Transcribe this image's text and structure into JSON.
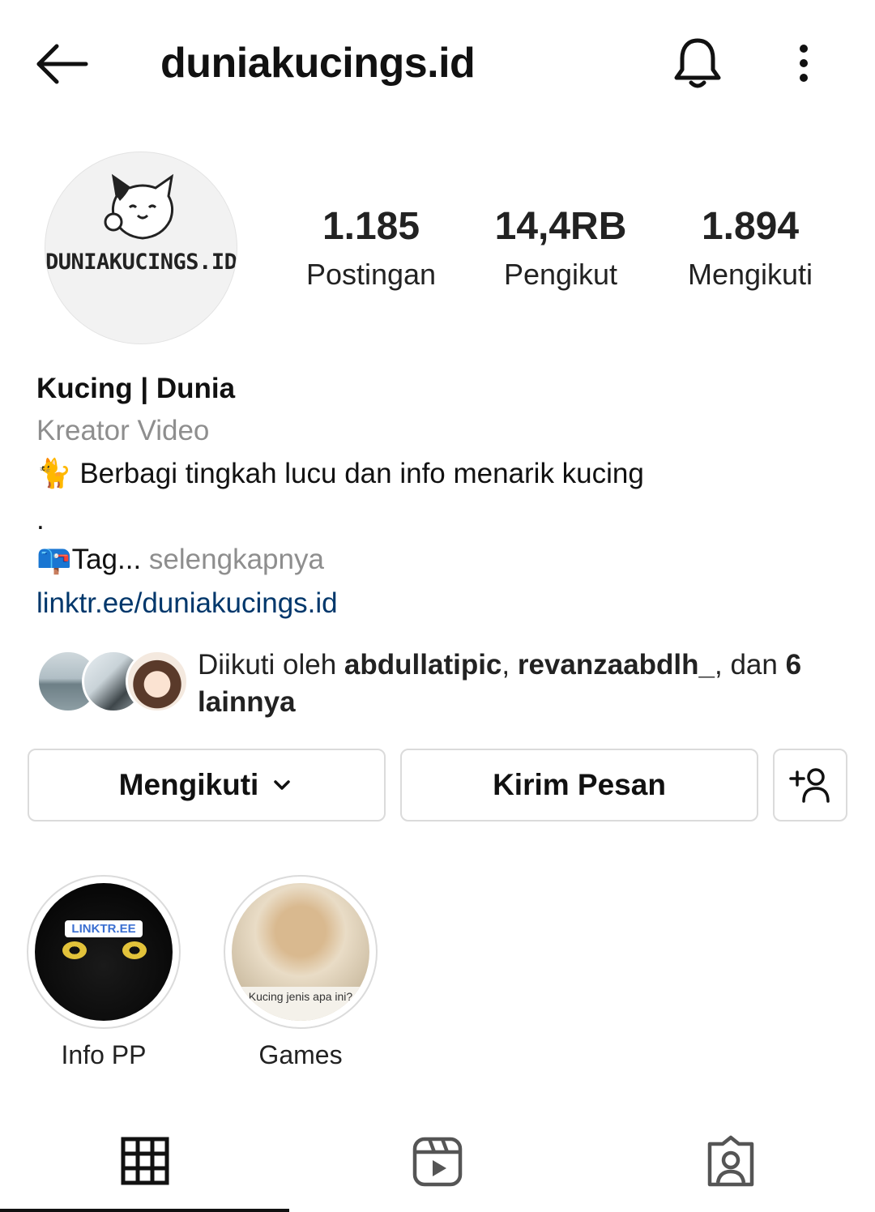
{
  "header": {
    "title": "duniakucings.id",
    "icons": [
      "back-arrow-icon",
      "bell-icon",
      "more-vertical-icon"
    ]
  },
  "profile": {
    "avatar_text": "DUNIAKUCINGS.ID",
    "stats": [
      {
        "value": "1.185",
        "label": "Postingan"
      },
      {
        "value": "14,4RB",
        "label": "Pengikut"
      },
      {
        "value": "1.894",
        "label": "Mengikuti"
      }
    ]
  },
  "bio": {
    "name": "Kucing | Dunia",
    "category": "Kreator Video",
    "line1_emoji": "🐈",
    "line1_text": "Berbagi tingkah lucu dan info menarik kucing",
    "line2": ".",
    "line3_emoji": "📪",
    "line3_text": "Tag...",
    "line3_more": " selengkapnya",
    "link": "linktr.ee/duniakucings.id"
  },
  "followed_by": {
    "prefix": "Diikuti oleh ",
    "user1": "abdullatipic",
    "sep": ", ",
    "user2": "revanzaabdlh_",
    "mid": ", dan ",
    "count": "6",
    "suffix": "lainnya"
  },
  "buttons": {
    "following": "Mengikuti",
    "message": "Kirim Pesan"
  },
  "highlights": [
    {
      "label": "Info PP",
      "inner_text": "LINKTR.EE"
    },
    {
      "label": "Games",
      "inner_text": "Kucing jenis apa ini?"
    }
  ],
  "tabs": [
    "grid-icon",
    "reels-icon",
    "tagged-icon"
  ],
  "colors": {
    "link": "#00376b",
    "secondary": "#8e8e8e",
    "border": "#dbdbdb"
  }
}
